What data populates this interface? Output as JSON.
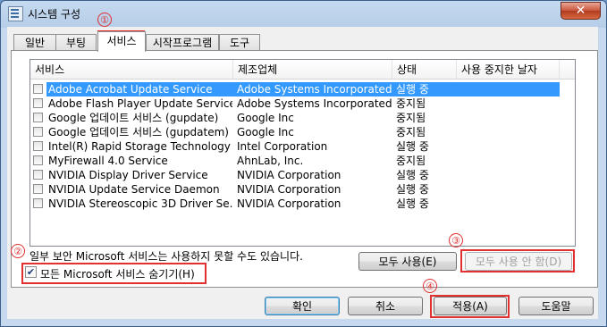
{
  "window": {
    "title": "시스템 구성",
    "close_glyph": "✕"
  },
  "tabs": [
    {
      "label": "일반"
    },
    {
      "label": "부팅"
    },
    {
      "label": "서비스"
    },
    {
      "label": "시작프로그램"
    },
    {
      "label": "도구"
    }
  ],
  "columns": {
    "service": "서비스",
    "manufacturer": "제조업체",
    "status": "상태",
    "date_disabled": "사용 중지한 날자"
  },
  "services": [
    {
      "name": "Adobe Acrobat Update Service",
      "manufacturer": "Adobe Systems Incorporated",
      "status": "실행 중",
      "date": ""
    },
    {
      "name": "Adobe Flash Player Update Service",
      "manufacturer": "Adobe Systems Incorporated",
      "status": "중지됨",
      "date": ""
    },
    {
      "name": "Google 업데이트 서비스 (gupdate)",
      "manufacturer": "Google Inc",
      "status": "중지됨",
      "date": ""
    },
    {
      "name": "Google 업데이트 서비스 (gupdatem)",
      "manufacturer": "Google Inc",
      "status": "중지됨",
      "date": ""
    },
    {
      "name": "Intel(R) Rapid Storage Technology",
      "manufacturer": "Intel Corporation",
      "status": "실행 중",
      "date": ""
    },
    {
      "name": "MyFirewall 4.0 Service",
      "manufacturer": "AhnLab, Inc.",
      "status": "중지됨",
      "date": ""
    },
    {
      "name": "NVIDIA Display Driver Service",
      "manufacturer": "NVIDIA Corporation",
      "status": "실행 중",
      "date": ""
    },
    {
      "name": "NVIDIA Update Service Daemon",
      "manufacturer": "NVIDIA Corporation",
      "status": "실행 중",
      "date": ""
    },
    {
      "name": "NVIDIA Stereoscopic 3D Driver Se...",
      "manufacturer": "NVIDIA Corporation",
      "status": "실행 중",
      "date": ""
    }
  ],
  "note": "일부 보안 Microsoft 서비스는 사용하지 못할 수도 있습니다.",
  "hide_ms": {
    "label": "모든 Microsoft 서비스 숨기기(H)",
    "checked": true,
    "check_glyph": "✔"
  },
  "buttons": {
    "enable_all": "모두 사용(E)",
    "disable_all": "모두 사용 안 함(D)",
    "ok": "확인",
    "cancel": "취소",
    "apply": "적용(A)",
    "help": "도움말"
  },
  "markers": [
    "①",
    "②",
    "③",
    "④"
  ],
  "colors": {
    "highlight": "#e03030",
    "selection": "#3399ff"
  }
}
